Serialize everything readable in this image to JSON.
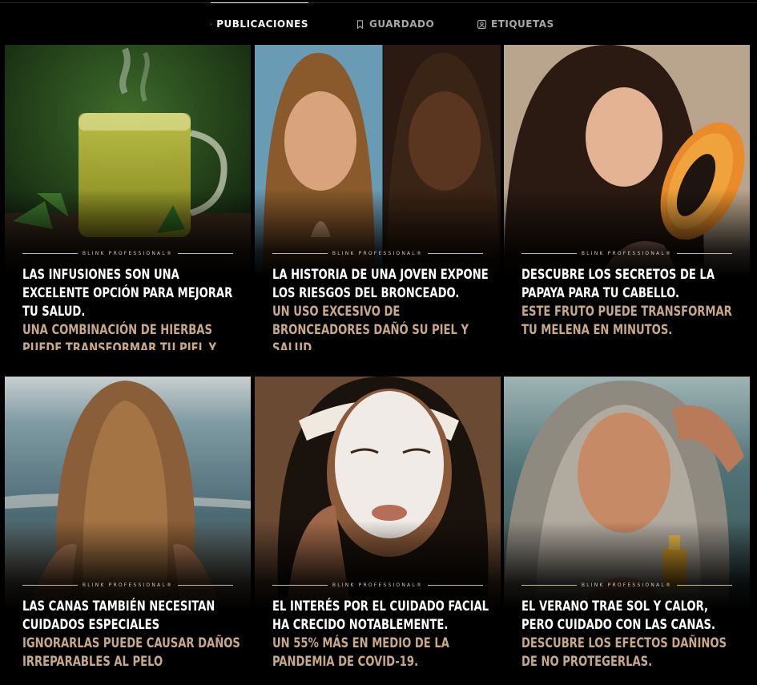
{
  "tabs": [
    {
      "label": "PUBLICACIONES",
      "icon": "grid-icon",
      "active": true
    },
    {
      "label": "GUARDADO",
      "icon": "bookmark-icon",
      "active": false
    },
    {
      "label": "ETIQUETAS",
      "icon": "tag-person-icon",
      "active": false
    }
  ],
  "posts": [
    {
      "image": "herbal-tea-photo",
      "brand": "BLINK PROFESSIONAL®",
      "title": "LAS INFUSIONES SON UNA EXCELENTE OPCIÓN PARA MEJORAR TU SALUD.",
      "subtitle": "UNA COMBINACIÓN DE HIERBAS PUEDE TRANSFORMAR TU PIEL Y ORGANISMO."
    },
    {
      "image": "tanning-before-after-photo",
      "brand": "BLINK PROFESSIONAL®",
      "title": "LA HISTORIA DE UNA JOVEN EXPONE LOS RIESGOS DEL BRONCEADO.",
      "subtitle": "UN USO EXCESIVO DE BRONCEADORES DAÑÓ SU PIEL Y SALUD."
    },
    {
      "image": "papaya-woman-photo",
      "brand": "BLINK PROFESSIONAL®",
      "title": "DESCUBRE LOS SECRETOS DE LA PAPAYA PARA TU CABELLO.",
      "subtitle": "ESTE FRUTO PUEDE TRANSFORMAR TU MELENA EN MINUTOS."
    },
    {
      "image": "beach-hair-photo",
      "brand": "BLINK PROFESSIONAL®",
      "title": "LAS CANAS TAMBIÉN NECESITAN CUIDADOS ESPECIALES",
      "subtitle": "IGNORARLAS PUEDE CAUSAR DAÑOS IRREPARABLES AL PELO"
    },
    {
      "image": "facial-mask-photo",
      "brand": "BLINK PROFESSIONAL®",
      "title": "EL INTERÉS POR EL CUIDADO FACIAL HA CRECIDO NOTABLEMENTE.",
      "subtitle": "UN 55% MÁS EN MEDIO DE LA PANDEMIA DE COVID-19."
    },
    {
      "image": "gray-hair-woman-photo",
      "brand": "BLINK PROFESSIONAL®",
      "title": "EL VERANO TRAE SOL Y CALOR, PERO CUIDADO CON LAS CANAS.",
      "subtitle": "DESCUBRE LOS EFECTOS DAÑINOS DE NO PROTEGERLAS."
    }
  ]
}
